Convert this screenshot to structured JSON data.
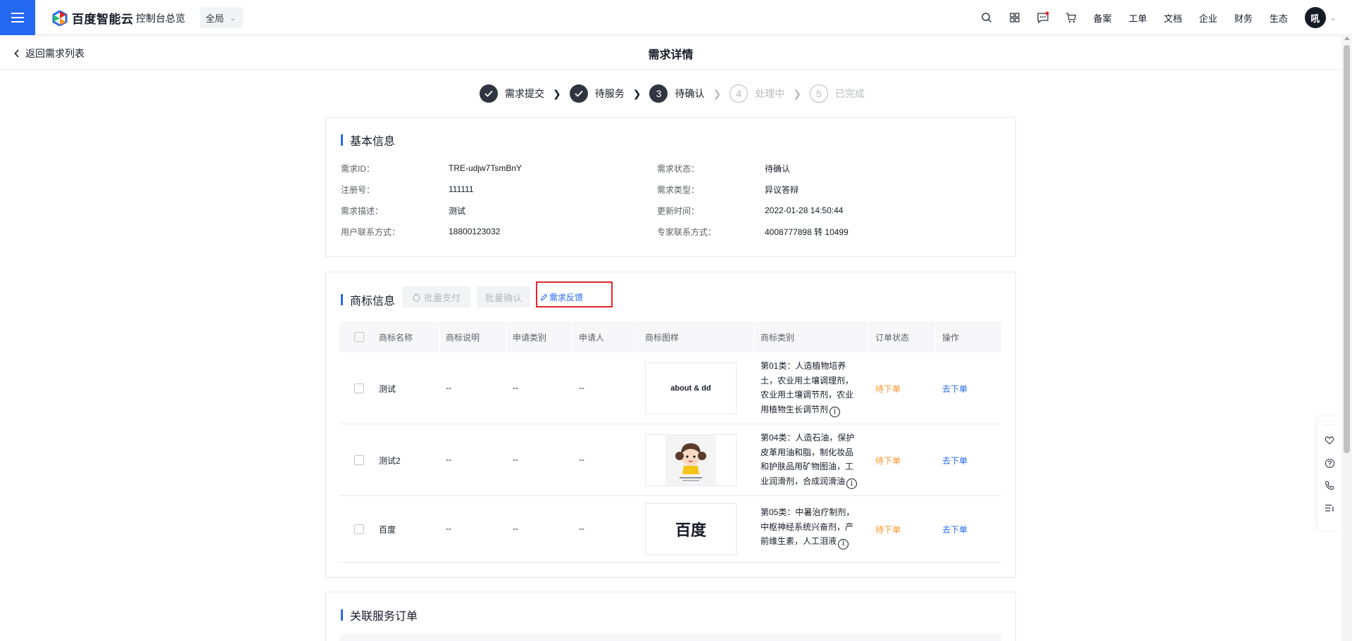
{
  "topbar": {
    "logo_text": "百度智能云",
    "console_link": "控制台总览",
    "region": "全局",
    "nav": [
      "备案",
      "工单",
      "文档",
      "企业",
      "财务",
      "生态"
    ],
    "avatar_text": "吼"
  },
  "subheader": {
    "back_label": "返回需求列表",
    "title": "需求详情"
  },
  "steps": [
    {
      "num": "1",
      "label": "需求提交",
      "state": "done"
    },
    {
      "num": "2",
      "label": "待服务",
      "state": "done"
    },
    {
      "num": "3",
      "label": "待确认",
      "state": "current"
    },
    {
      "num": "4",
      "label": "处理中",
      "state": "pending"
    },
    {
      "num": "5",
      "label": "已完成",
      "state": "pending"
    }
  ],
  "basic_info": {
    "title": "基本信息",
    "rows": [
      {
        "k1": "需求ID：",
        "v1": "TRE-udjw7TsmBnY",
        "k2": "需求状态：",
        "v2": "待确认"
      },
      {
        "k1": "注册号：",
        "v1": "111111",
        "k2": "需求类型：",
        "v2": "异议答辩"
      },
      {
        "k1": "需求描述：",
        "v1": "测试",
        "k2": "更新时间：",
        "v2": "2022-01-28 14:50:44"
      },
      {
        "k1": "用户联系方式：",
        "v1": "18800123032",
        "k2": "专家联系方式：",
        "v2": "4008777898 转 10499"
      }
    ]
  },
  "trademark": {
    "title": "商标信息",
    "batch_pay": "批量支付",
    "batch_confirm": "批量确认",
    "feedback": "需求反馈",
    "columns": [
      "商标名称",
      "商标说明",
      "申请类别",
      "申请人",
      "商标图样",
      "商标类别",
      "订单状态",
      "操作"
    ],
    "rows": [
      {
        "name": "测试",
        "desc": "--",
        "apply_class": "--",
        "applicant": "--",
        "preview_text": "about & dd",
        "class_text": "第01类：人造植物培养土，农业用土壤调理剂，农业用土壤调节剂，农业用植物生长调节剂",
        "status": "待下单",
        "action": "去下单"
      },
      {
        "name": "测试2",
        "desc": "--",
        "apply_class": "--",
        "applicant": "--",
        "preview_text": "",
        "class_text": "第04类：人造石油，保护皮革用油和脂，制化妆品和护肤品用矿物图油，工业润滑剂，合成润滑油",
        "status": "待下单",
        "action": "去下单"
      },
      {
        "name": "百度",
        "desc": "--",
        "apply_class": "--",
        "applicant": "--",
        "preview_text": "百度",
        "class_text": "第05类：中暑治疗制剂，中枢神经系统兴奋剂，产前维生素，人工泪液",
        "status": "待下单",
        "action": "去下单"
      }
    ]
  },
  "related_orders": {
    "title": "关联服务订单"
  },
  "colors": {
    "primary": "#2468f2",
    "pending": "#ff9326",
    "highlight_border": "#e0272c"
  }
}
